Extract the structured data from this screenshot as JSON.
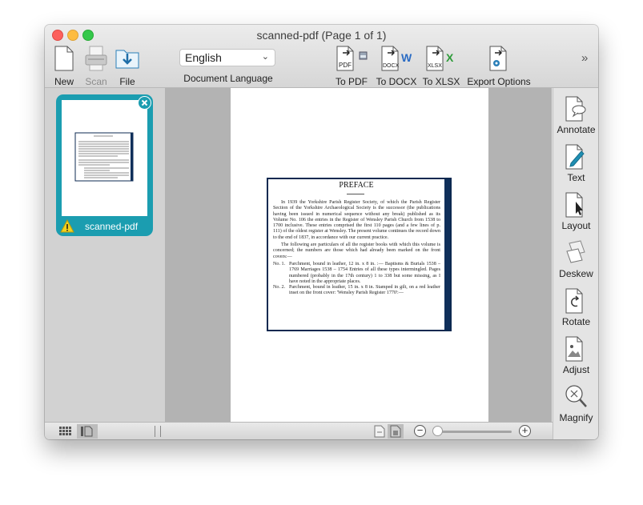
{
  "window": {
    "title": "scanned-pdf (Page 1 of 1)"
  },
  "toolbar": {
    "new_label": "New",
    "scan_label": "Scan",
    "file_label": "File",
    "language_value": "English",
    "language_label": "Document Language",
    "to_pdf_label": "To PDF",
    "to_docx_label": "To DOCX",
    "to_xlsx_label": "To XLSX",
    "export_options_label": "Export Options",
    "overflow": "»",
    "pdf_badge": "PDF",
    "docx_badge": "DOCX",
    "xlsx_badge": "XLSX"
  },
  "sidebar": {
    "thumbnail_filename": "scanned-pdf"
  },
  "document": {
    "title": "PREFACE",
    "paragraph1": "In 1939 the Yorkshire Parish Register Society, of which the Parish Register Section of the Yorkshire Archaeological Society is the successor (the publications having been issued in numerical sequence without any break) published as its Volume No. 106 the entries in the Register of Wensley Parish Church from 1538 to 1700 inclusive. These entries comprised the first 110 pages (and a few lines of p. 111) of the oldest register at Wensley. The present volume continues the record down to the end of 1837, in accordance with our current practice.",
    "paragraph2": "The following are particulars of all the register books with which this volume is concerned; the numbers are those which had already been marked on the front covers:—",
    "item1_num": "No. 1.",
    "item1_text": "Parchment, bound in leather, 12 in. x 8 in. :— Baptisms & Burials 1538 – 1769 Marriages 1538 – 1754 Entries of all these types intermingled. Pages numbered (probably in the 17th century) 1 to 338 but some missing, as I have noted in the appropriate places.",
    "item2_num": "No. 2.",
    "item2_text": "Parchment, bound in leather, 15 in. x 8 in. Stamped in gilt, on a red leather inset on the front cover: 'Wensley Parish Register 1770':—"
  },
  "rightbar": {
    "annotate_label": "Annotate",
    "text_label": "Text",
    "layout_label": "Layout",
    "deskew_label": "Deskew",
    "rotate_label": "Rotate",
    "adjust_label": "Adjust",
    "magnify_label": "Magnify"
  },
  "statusbar": {
    "zoom_out": "−",
    "zoom_in": "+",
    "zoom_level": 0.0
  },
  "colors": {
    "accent": "#1b9db0",
    "docx_blue": "#2b6cc4",
    "xlsx_green": "#2e9b3a",
    "pdf_arrow": "#222222"
  }
}
